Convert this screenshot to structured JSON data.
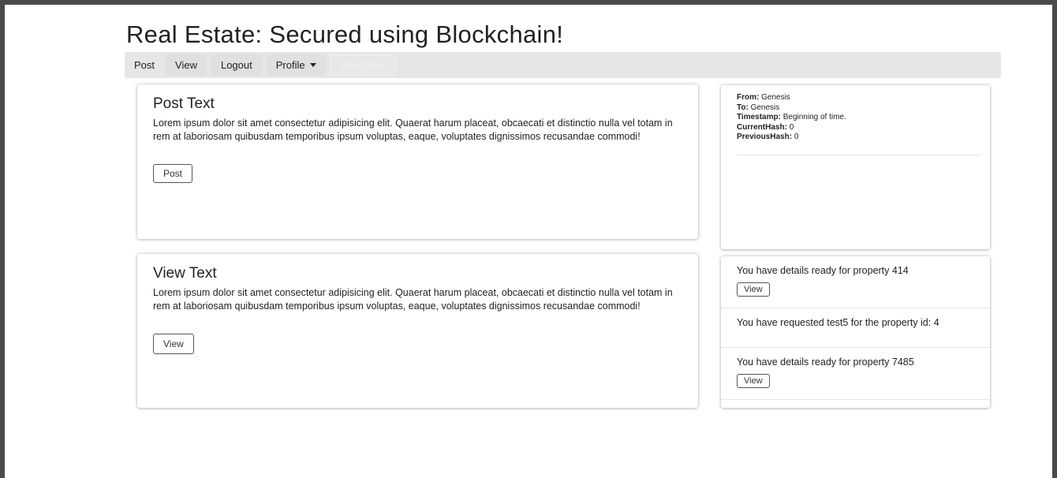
{
  "header": {
    "title": "Real Estate: Secured using Blockchain!"
  },
  "nav": {
    "items": [
      {
        "label": "Post"
      },
      {
        "label": "View"
      },
      {
        "label": "Logout"
      },
      {
        "label": "Profile"
      },
      {
        "label": "Dev Clear"
      }
    ]
  },
  "post_card": {
    "title": "Post Text",
    "body": "Lorem ipsum dolor sit amet consectetur adipisicing elit. Quaerat harum placeat, obcaecati et distinctio nulla vel totam in rem at laboriosam quibusdam temporibus ipsum voluptas, eaque, voluptates dignissimos recusandae commodi!",
    "button": "Post"
  },
  "view_card": {
    "title": "View Text",
    "body": "Lorem ipsum dolor sit amet consectetur adipisicing elit. Quaerat harum placeat, obcaecati et distinctio nulla vel totam in rem at laboriosam quibusdam temporibus ipsum voluptas, eaque, voluptates dignissimos recusandae commodi!",
    "button": "View"
  },
  "chain": {
    "from_label": "From:",
    "from_value": "Genesis",
    "to_label": "To:",
    "to_value": "Genesis",
    "timestamp_label": "Timestamp:",
    "timestamp_value": "Beginning of time.",
    "current_hash_label": "CurrentHash:",
    "current_hash_value": "0",
    "previous_hash_label": "PreviousHash:",
    "previous_hash_value": "0"
  },
  "notifications": [
    {
      "text": "You have details ready for property 414",
      "button": "View"
    },
    {
      "text": "You have requested test5 for the property id: 4"
    },
    {
      "text": "You have details ready for property 7485",
      "button": "View"
    }
  ]
}
